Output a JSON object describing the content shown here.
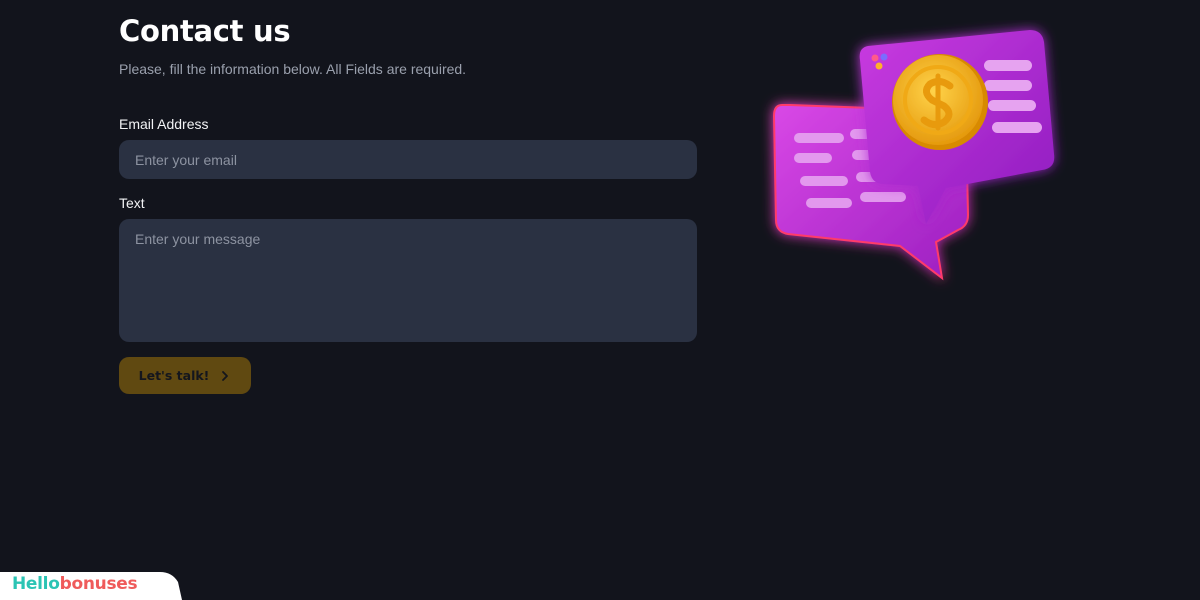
{
  "page": {
    "title": "Contact us",
    "subtitle": "Please, fill the information below. All Fields are required."
  },
  "form": {
    "email_label": "Email Address",
    "email_placeholder": "Enter your email",
    "email_value": "",
    "text_label": "Text",
    "text_placeholder": "Enter your message",
    "text_value": "",
    "submit_label": "Let's talk!"
  },
  "illustration": {
    "name": "chat-bubbles-with-coin",
    "colors": {
      "bubble": "#c23ad6",
      "bubble_dark": "#8a1fb0",
      "coin": "#f6b51b",
      "lines": "#e6a3f0"
    }
  },
  "brand": {
    "part1": "Hell",
    "part2": "o",
    "part3": "bonuses"
  },
  "colors": {
    "background": "#12141c",
    "input_bg": "#2a3142",
    "button_bg": "#604911",
    "brand_teal": "#2bc4b4",
    "brand_red": "#ef5b5b"
  }
}
